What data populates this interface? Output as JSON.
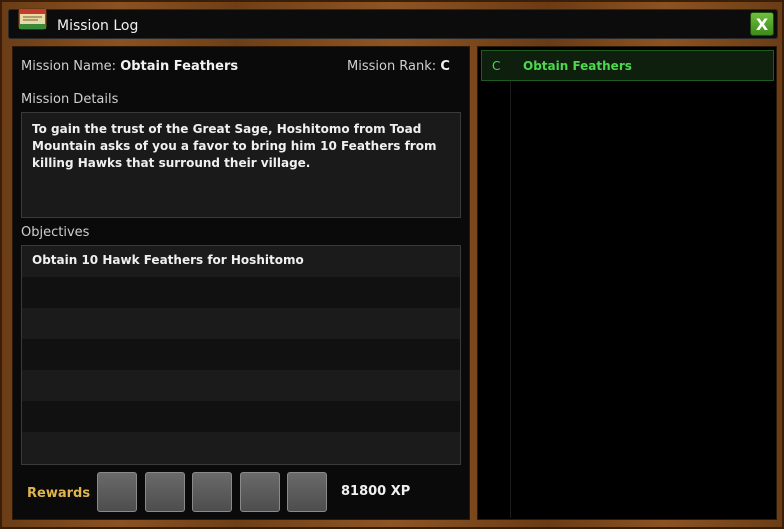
{
  "window": {
    "title": "Mission Log",
    "close_label": "X"
  },
  "mission": {
    "name_label": "Mission Name:",
    "name": "Obtain Feathers",
    "rank_label": "Mission Rank:",
    "rank": "C",
    "details_label": "Mission Details",
    "details": "To gain the trust of the Great Sage, Hoshitomo from Toad Mountain asks of you a favor to bring him 10 Feathers from killing Hawks that surround their village.",
    "objectives_label": "Objectives",
    "objectives": [
      "Obtain 10 Hawk Feathers for Hoshitomo",
      "",
      "",
      "",
      "",
      "",
      ""
    ]
  },
  "rewards": {
    "label": "Rewards",
    "slots": 5,
    "xp": "81800 XP"
  },
  "mission_list": [
    {
      "rank": "C",
      "name": "Obtain Feathers",
      "selected": true
    }
  ],
  "colors": {
    "accent_green": "#4dd84d",
    "rewards_gold": "#e0b64a",
    "close_green": "#5aae2e"
  },
  "icons": [
    "scroll-log-icon",
    "close-icon"
  ]
}
